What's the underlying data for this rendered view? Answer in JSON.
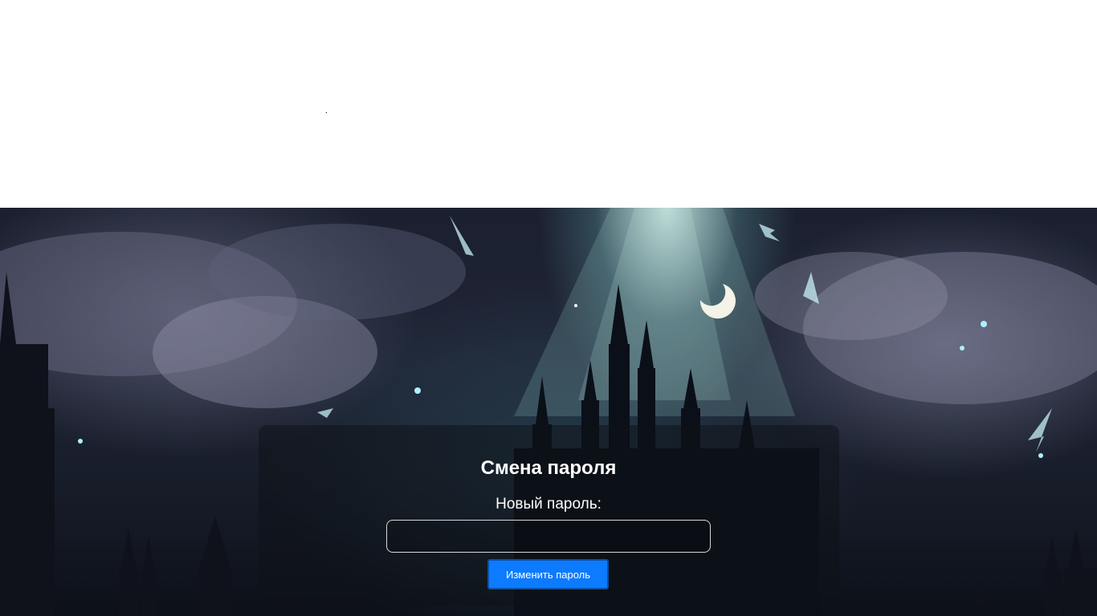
{
  "header": {
    "dot_text": "."
  },
  "form": {
    "title": "Смена пароля",
    "new_password_label": "Новый пароль:",
    "new_password_value": "",
    "submit_label": "Изменить пароль"
  },
  "colors": {
    "button_bg": "#0d7bff",
    "panel_bg": "rgba(15,18,24,0.55)",
    "text": "#ffffff"
  }
}
